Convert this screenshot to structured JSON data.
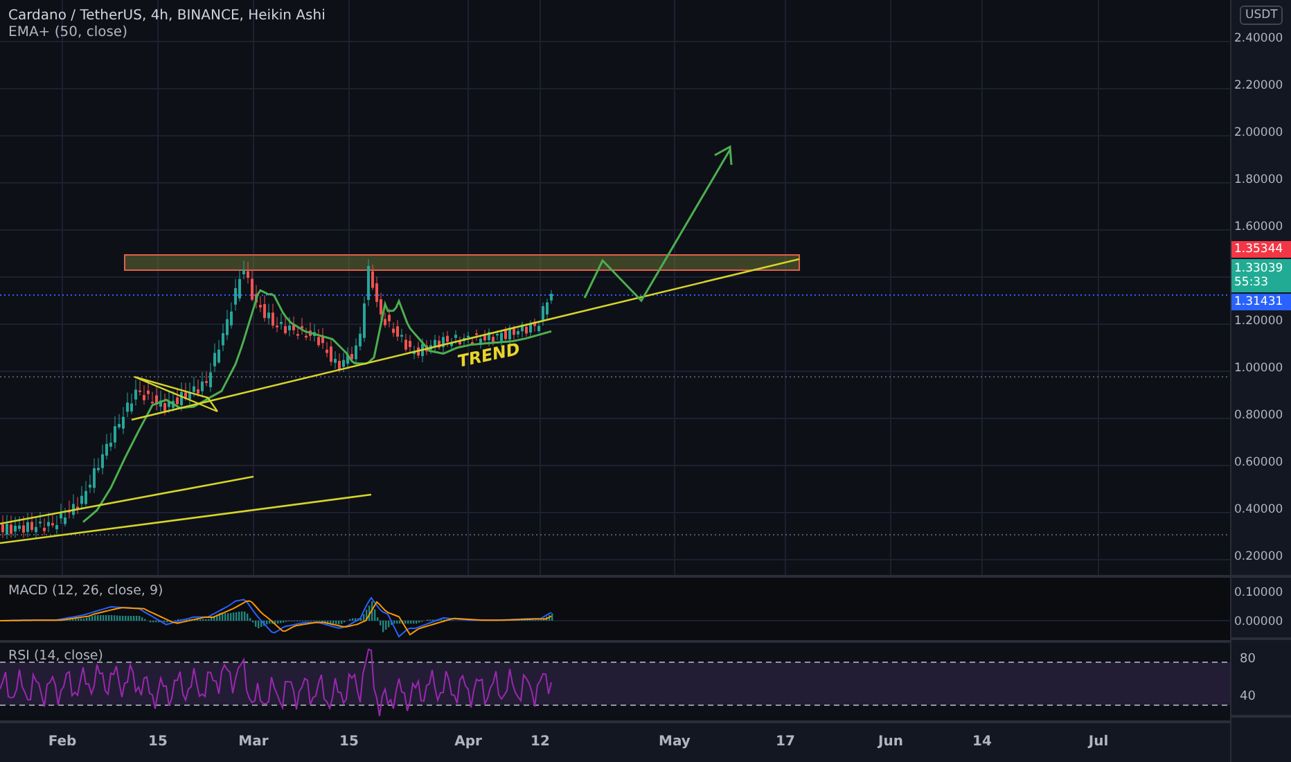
{
  "legend": {
    "symbol": "Cardano / TetherUS, 4h, BINANCE, Heikin Ashi",
    "indicator": "EMA+ (50, close)"
  },
  "currency_button": "USDT",
  "price_axis": {
    "labels": [
      "2.40000",
      "2.20000",
      "2.00000",
      "1.80000",
      "1.60000",
      "1.20000",
      "1.00000",
      "0.80000",
      "0.60000",
      "0.40000",
      "0.20000"
    ]
  },
  "price_tags": [
    {
      "kind": "ask",
      "color": "#f23645",
      "value": "1.35344"
    },
    {
      "kind": "last",
      "color": "#22ab94",
      "value": "1.33039",
      "countdown": "55:33"
    },
    {
      "kind": "bid",
      "color": "#2962ff",
      "value": "1.31431"
    }
  ],
  "annotation": "TREND",
  "macd": {
    "legend": "MACD (12, 26, close, 9)",
    "axis_labels": [
      "0.10000",
      "0.00000"
    ]
  },
  "rsi": {
    "legend": "RSI (14, close)",
    "axis_labels": [
      "80",
      "40"
    ]
  },
  "time_axis": {
    "labels": [
      "Feb",
      "15",
      "Mar",
      "15",
      "Apr",
      "12",
      "May",
      "17",
      "Jun",
      "14",
      "Jul"
    ]
  }
}
